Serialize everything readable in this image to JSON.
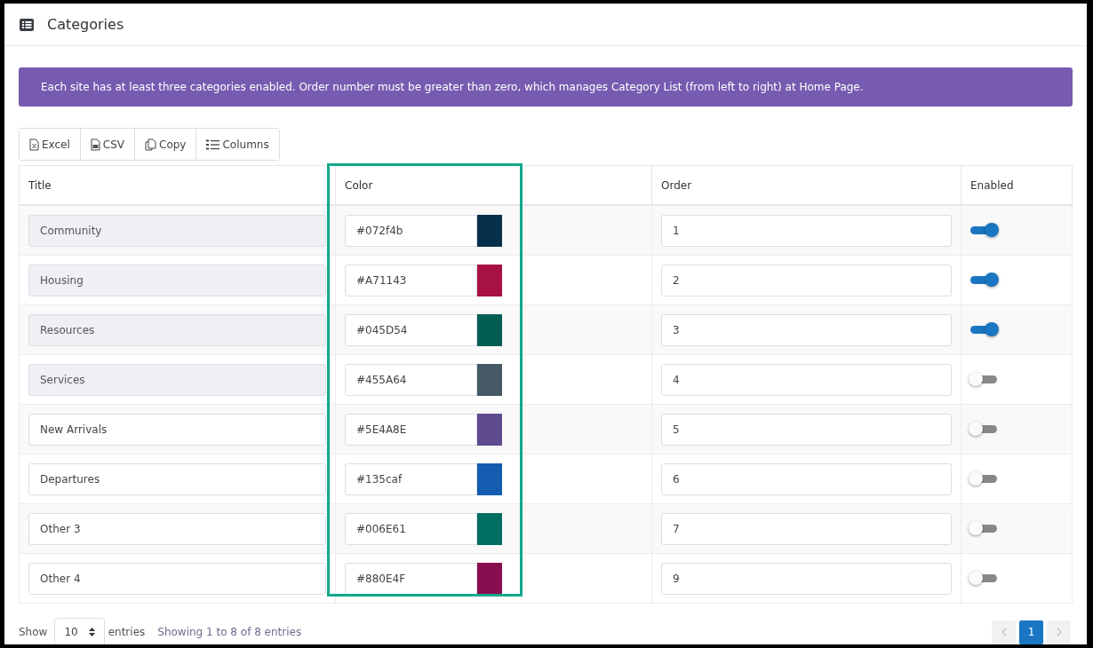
{
  "header": {
    "title": "Categories"
  },
  "alert": {
    "text": "Each site has at least three categories enabled. Order number must be greater than zero, which manages Category List (from left to right) at Home Page."
  },
  "export_buttons": [
    {
      "label": "Excel",
      "kind": "excel"
    },
    {
      "label": "CSV",
      "kind": "csv"
    },
    {
      "label": "Copy",
      "kind": "copy"
    },
    {
      "label": "Columns",
      "kind": "columns"
    }
  ],
  "table": {
    "columns": [
      "Title",
      "Color",
      "Order",
      "Enabled"
    ],
    "rows": [
      {
        "title": "Community",
        "title_locked": true,
        "color": "#072f4b",
        "order": "1",
        "enabled": true
      },
      {
        "title": "Housing",
        "title_locked": true,
        "color": "#A71143",
        "order": "2",
        "enabled": true
      },
      {
        "title": "Resources",
        "title_locked": true,
        "color": "#045D54",
        "order": "3",
        "enabled": true
      },
      {
        "title": "Services",
        "title_locked": true,
        "color": "#455A64",
        "order": "4",
        "enabled": false
      },
      {
        "title": "New Arrivals",
        "title_locked": false,
        "color": "#5E4A8E",
        "order": "5",
        "enabled": false
      },
      {
        "title": "Departures",
        "title_locked": false,
        "color": "#135caf",
        "order": "6",
        "enabled": false
      },
      {
        "title": "Other 3",
        "title_locked": false,
        "color": "#006E61",
        "order": "7",
        "enabled": false
      },
      {
        "title": "Other 4",
        "title_locked": false,
        "color": "#880E4F",
        "order": "9",
        "enabled": false
      }
    ]
  },
  "footer": {
    "show_label": "Show",
    "page_size": "10",
    "entries_label": "entries",
    "info": "Showing 1 to 8 of 8 entries",
    "pages": [
      {
        "label": "1",
        "selected": true
      }
    ]
  }
}
